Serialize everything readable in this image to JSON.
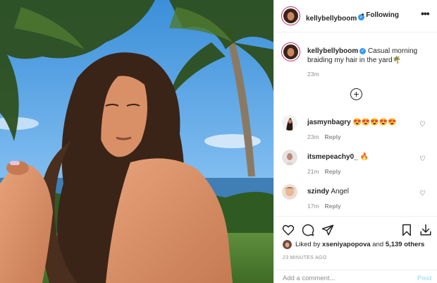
{
  "post": {
    "image_alt": "Woman with long braided hair outdoors under palm trees by the ocean",
    "author": {
      "username": "kellybellyboom",
      "follow_state": "Following",
      "more_label": "•••"
    },
    "caption": {
      "username": "kellybellyboom",
      "text": "Casual morning braiding my hair in the yard🌴",
      "time": "23m"
    },
    "load_more_label": "+",
    "comments": [
      {
        "username": "jasmynbagry",
        "text": "😍😍😍😍😍",
        "time": "23m",
        "reply": "Reply"
      },
      {
        "username": "itsmepeachy0_",
        "text": "🔥",
        "time": "21m",
        "reply": "Reply"
      },
      {
        "username": "szindy",
        "text": "Angel",
        "time": "17m",
        "reply": "Reply"
      }
    ],
    "actions": {
      "like": "heart-icon",
      "comment": "comment-icon",
      "share": "send-icon",
      "save": "bookmark-icon",
      "download": "download-icon"
    },
    "likes": {
      "prefix": "Liked by ",
      "user": "xseniyapopova",
      "middle": " and ",
      "count": "5,139 others"
    },
    "timestamp": "23 MINUTES AGO",
    "add_comment": {
      "placeholder": "Add a comment...",
      "post_label": "Post"
    }
  },
  "colors": {
    "verified": "#3897f0",
    "story_ring": "#c92c6a",
    "post_disabled": "#b2dffc",
    "muted": "#8e8e8e"
  }
}
